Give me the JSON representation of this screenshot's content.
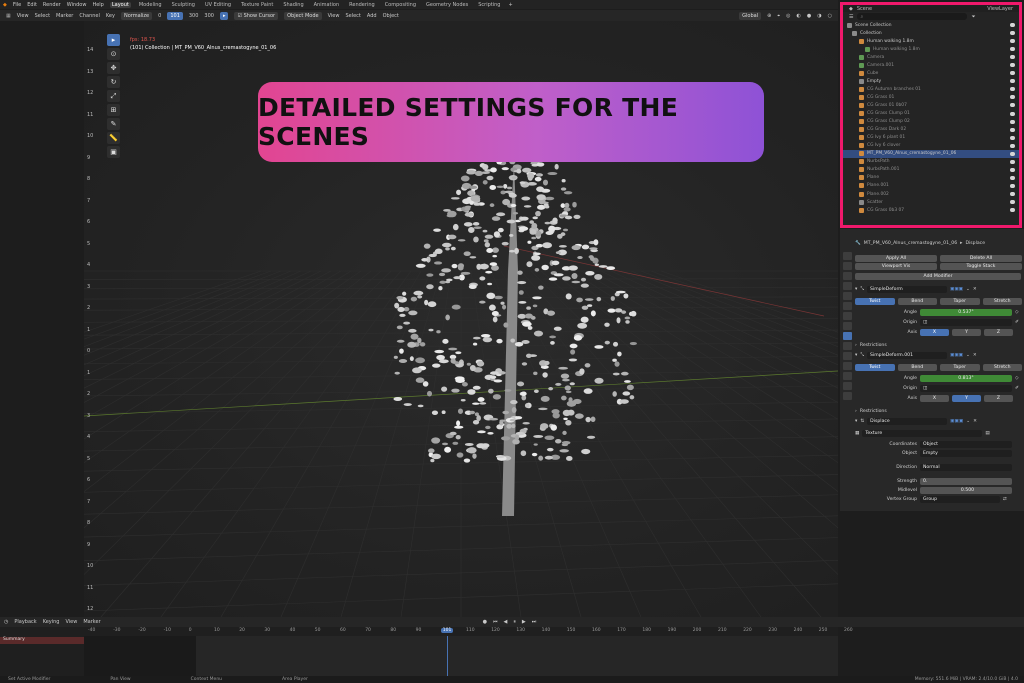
{
  "topbar": {
    "menus": [
      "File",
      "Edit",
      "Render",
      "Window",
      "Help"
    ],
    "workspaces": [
      "Layout",
      "Modeling",
      "Sculpting",
      "UV Editing",
      "Texture Paint",
      "Shading",
      "Animation",
      "Rendering",
      "Compositing",
      "Geometry Nodes",
      "Scripting"
    ],
    "active_workspace": "Layout",
    "scene_label": "Scene",
    "view_layer_label": "ViewLayer"
  },
  "header2": {
    "left_items": [
      "View",
      "Select",
      "Marker",
      "Channel",
      "Key"
    ],
    "normalize": "Normalize",
    "frame_values": [
      "0",
      "101",
      "300",
      "300"
    ],
    "show_cursor": "Show Cursor",
    "object_mode": "Object Mode",
    "view_items": [
      "View",
      "Select",
      "Add",
      "Object"
    ],
    "transform": "Global"
  },
  "viewport": {
    "fps": "fps: 18.73",
    "collection": "(101) Collection | MT_PM_V60_Alnus_cremastogyne_01_06",
    "ruler_ticks": [
      "14",
      "13",
      "12",
      "11",
      "10",
      "9",
      "8",
      "7",
      "6",
      "5",
      "4",
      "3",
      "2",
      "1",
      "0",
      "1",
      "2",
      "3",
      "4",
      "5",
      "6",
      "7",
      "8",
      "9",
      "10",
      "11",
      "12"
    ],
    "banner": "DETAILED SETTINGS FOR THE SCENES"
  },
  "outliner": {
    "search_placeholder": "",
    "rows": [
      {
        "name": "Scene Collection",
        "type": "grey",
        "dim": false
      },
      {
        "name": "Collection",
        "type": "grey",
        "dim": false
      },
      {
        "name": "Human walking 1.8m",
        "type": "orange",
        "dim": false
      },
      {
        "name": "Human walking 1.8m",
        "type": "green",
        "dim": true
      },
      {
        "name": "Camera",
        "type": "green",
        "dim": true
      },
      {
        "name": "Camera.001",
        "type": "green",
        "dim": true
      },
      {
        "name": "Cube",
        "type": "orange",
        "dim": true
      },
      {
        "name": "Empty",
        "type": "grey",
        "dim": false
      },
      {
        "name": "CG Autumn branches 01",
        "type": "orange",
        "dim": true
      },
      {
        "name": "CG Grass 01",
        "type": "orange",
        "dim": true
      },
      {
        "name": "CG Grass 01 0b07",
        "type": "orange",
        "dim": true
      },
      {
        "name": "CG Grass Clump 01",
        "type": "orange",
        "dim": true
      },
      {
        "name": "CG Grass Clump 02",
        "type": "orange",
        "dim": true
      },
      {
        "name": "CG Grass Dark 02",
        "type": "orange",
        "dim": true
      },
      {
        "name": "CG Ivy 6 plant 01",
        "type": "orange",
        "dim": true
      },
      {
        "name": "CG Ivy 6 clover",
        "type": "orange",
        "dim": true
      },
      {
        "name": "MT_PM_V60_Alnus_cremastogyne_01_06",
        "type": "orange",
        "dim": false
      },
      {
        "name": "NurbsPath",
        "type": "orange",
        "dim": true
      },
      {
        "name": "NurbsPath.001",
        "type": "orange",
        "dim": true
      },
      {
        "name": "Plane",
        "type": "orange",
        "dim": true
      },
      {
        "name": "Plane.001",
        "type": "orange",
        "dim": true
      },
      {
        "name": "Plane.002",
        "type": "orange",
        "dim": true
      },
      {
        "name": "Scatter",
        "type": "grey",
        "dim": true
      },
      {
        "name": "CG Grass 0b3 07",
        "type": "orange",
        "dim": true
      }
    ]
  },
  "properties": {
    "object_name": "MT_PM_V60_Alnus_cremastogyne_01_06",
    "displace_label": "Displace",
    "apply_all": "Apply All",
    "delete_all": "Delete All",
    "viewport_vis": "Viewport Vis",
    "toggle_stack": "Toggle Stack",
    "add_modifier": "Add Modifier",
    "mod1": {
      "name": "SimpleDeform",
      "tabs": [
        "Twist",
        "Bend",
        "Taper",
        "Stretch"
      ],
      "active_tab": "Twist",
      "angle_label": "Angle",
      "angle_value": "0.537°",
      "origin_label": "Origin",
      "axis_label": "Axis",
      "axes": [
        "X",
        "Y",
        "Z"
      ],
      "active_axis": "X",
      "restrictions": "Restrictions"
    },
    "mod2": {
      "name": "SimpleDeform.001",
      "tabs": [
        "Twist",
        "Bend",
        "Taper",
        "Stretch"
      ],
      "active_tab": "Twist",
      "angle_label": "Angle",
      "angle_value": "0.813°",
      "origin_label": "Origin",
      "axis_label": "Axis",
      "axes": [
        "X",
        "Y",
        "Z"
      ],
      "active_axis": "Y",
      "restrictions": "Restrictions"
    },
    "mod3": {
      "name": "Displace",
      "texture_label": "Texture",
      "coordinates_label": "Coordinates",
      "coordinates_value": "Object",
      "object_label": "Object",
      "object_value": "Empty",
      "direction_label": "Direction",
      "direction_value": "Normal",
      "strength_label": "Strength",
      "strength_value": "0.",
      "midlevel_label": "Midlevel",
      "midlevel_value": "0.500",
      "vertex_group_label": "Vertex Group",
      "vertex_group_value": "Group"
    }
  },
  "timeline": {
    "header_items": [
      "Playback",
      "Keying",
      "View",
      "Marker"
    ],
    "summary": "Summary",
    "ticks": [
      "-40",
      "-30",
      "-20",
      "-10",
      "0",
      "10",
      "20",
      "30",
      "40",
      "50",
      "60",
      "70",
      "80",
      "90",
      "101",
      "110",
      "120",
      "130",
      "140",
      "150",
      "160",
      "170",
      "180",
      "190",
      "200",
      "210",
      "220",
      "230",
      "240",
      "250",
      "260"
    ],
    "current_frame": "101"
  },
  "status": {
    "left": "Set Active Modifier",
    "middle": "Pan View",
    "context": "Context Menu",
    "mode": "Area Player",
    "memory": "Memory: 551.6 MiB | VRAM: 2.4/10.0 GiB | 4.0"
  },
  "colors": {
    "accent": "#4772b3",
    "highlight_frame": "#f0196c",
    "banner_start": "#e24591",
    "banner_end": "#8e52d6",
    "angle_field": "#3f8a36"
  }
}
